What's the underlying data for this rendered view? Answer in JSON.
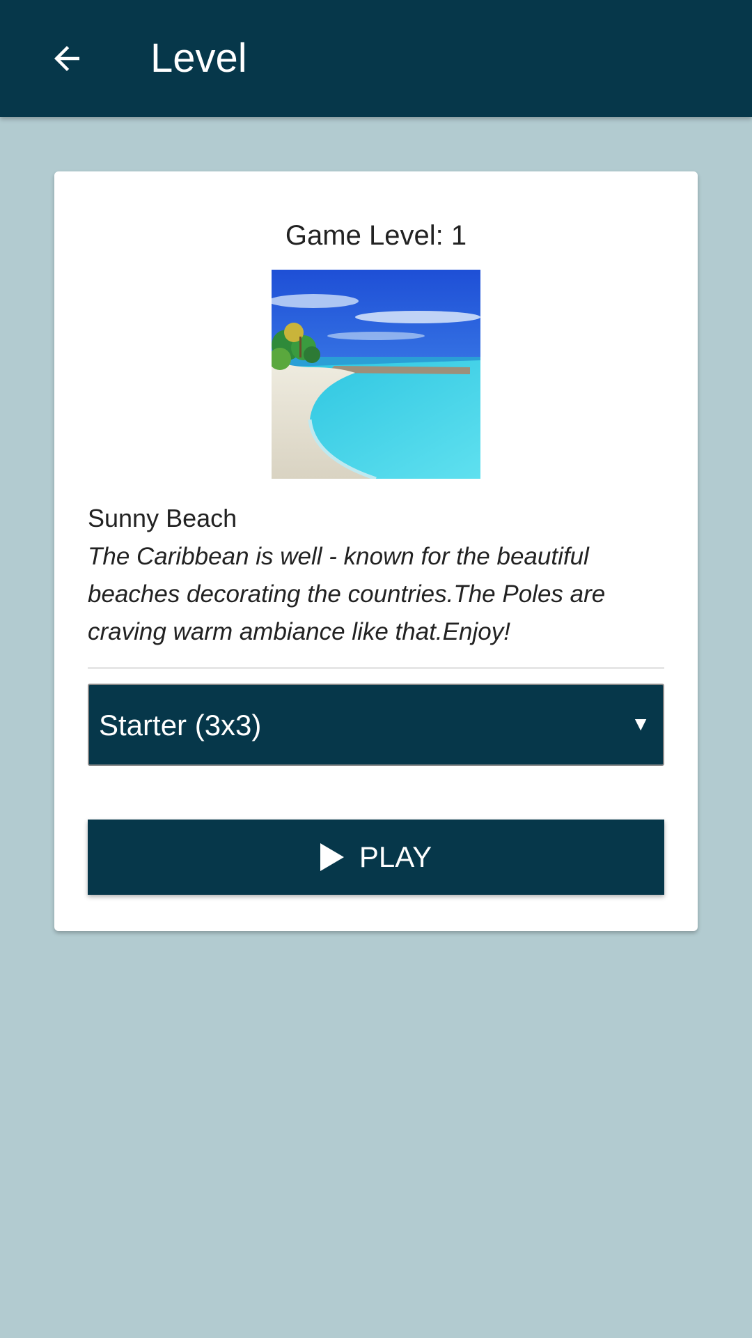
{
  "appbar": {
    "title": "Level",
    "back_icon": "arrow-back-icon"
  },
  "card": {
    "heading": "Game Level: 1",
    "image": "beach-image",
    "name": "Sunny Beach",
    "description": "The Caribbean is well - known for the beautiful beaches decorating the countries.The Poles are craving warm ambiance like that.Enjoy!",
    "difficulty": {
      "selected": "Starter (3x3)",
      "arrow": "▼"
    },
    "play": {
      "label": "PLAY",
      "icon": "play-icon"
    }
  },
  "colors": {
    "primary": "#06374a",
    "background": "#b2cbd0",
    "card": "#ffffff",
    "text": "#222222"
  }
}
